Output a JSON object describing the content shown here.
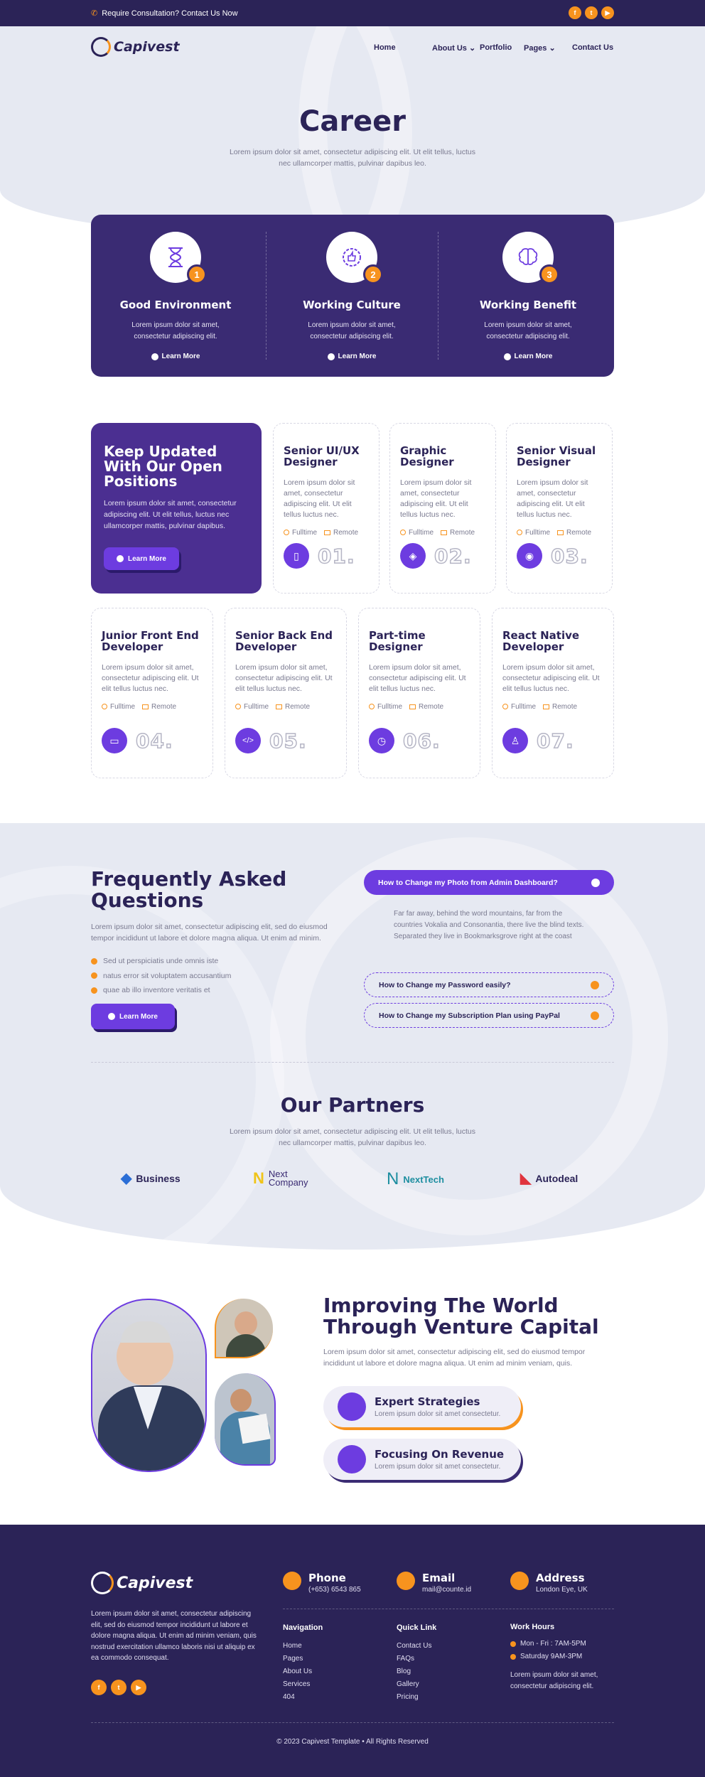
{
  "topbar": {
    "consultation": "Require Consultation? Contact Us Now",
    "socials": [
      "facebook-icon",
      "twitter-icon",
      "youtube-icon"
    ]
  },
  "brand": {
    "name": "Capivest",
    "accent": "#f7931e",
    "primary": "#2b2357",
    "purple": "#6d3ce0"
  },
  "nav": {
    "home": "Home",
    "about": "About Us",
    "portfolio": "Portfolio",
    "pages": "Pages",
    "contact": "Contact Us"
  },
  "hero": {
    "title": "Career",
    "subtitle": "Lorem ipsum dolor sit amet, consectetur adipiscing elit. Ut elit tellus, luctus nec ullamcorper mattis, pulvinar dapibus leo."
  },
  "features": [
    {
      "num": "1",
      "title": "Good Environment",
      "text": "Lorem ipsum dolor sit amet, consectetur adipiscing elit.",
      "link": "Learn More"
    },
    {
      "num": "2",
      "title": "Working Culture",
      "text": "Lorem ipsum dolor sit amet, consectetur adipiscing elit.",
      "link": "Learn More"
    },
    {
      "num": "3",
      "title": "Working Benefit",
      "text": "Lorem ipsum dolor sit amet, consectetur adipiscing elit.",
      "link": "Learn More"
    }
  ],
  "open": {
    "title": "Keep Updated With Our Open Positions",
    "text": "Lorem ipsum dolor sit amet, consectetur adipiscing elit. Ut elit tellus, luctus nec ullamcorper mattis, pulvinar dapibus.",
    "button": "Learn More"
  },
  "job_text": "Lorem ipsum dolor sit amet, consectetur adipiscing elit. Ut elit tellus luctus nec.",
  "job_type": "Fulltime",
  "job_place": "Remote",
  "jobs": [
    {
      "title": "Senior UI/UX Designer",
      "num": "01."
    },
    {
      "title": "Graphic Designer",
      "num": "02."
    },
    {
      "title": "Senior Visual Designer",
      "num": "03."
    },
    {
      "title": "Junior Front End Developer",
      "num": "04."
    },
    {
      "title": "Senior Back End Developer",
      "num": "05."
    },
    {
      "title": "Part-time Designer",
      "num": "06."
    },
    {
      "title": "React Native Developer",
      "num": "07."
    }
  ],
  "faq": {
    "title": "Frequently Asked Questions",
    "desc": "Lorem ipsum dolor sit amet, consectetur adipiscing elit, sed do eiusmod tempor incididunt ut labore et dolore magna aliqua. Ut enim ad minim.",
    "bullets": [
      "Sed ut perspiciatis unde omnis iste",
      "natus error sit voluptatem accusantium",
      "quae ab illo inventore veritatis et"
    ],
    "button": "Learn More",
    "open_q": "How to Change my Photo from Admin Dashboard?",
    "open_a": "Far far away, behind the word mountains, far from the countries Vokalia and Consonantia, there live the blind texts. Separated they live in Bookmarksgrove right at the coast",
    "q2": "How to Change my Password easily?",
    "q3": "How to Change my Subscription Plan using PayPal"
  },
  "partners": {
    "title": "Our Partners",
    "subtitle": "Lorem ipsum dolor sit amet, consectetur adipiscing elit. Ut elit tellus, luctus nec ullamcorper mattis, pulvinar dapibus leo.",
    "logos": [
      "Business",
      "Next Company",
      "NextTech",
      "Autodeal"
    ]
  },
  "improve": {
    "title": "Improving The World Through Venture Capital",
    "desc": "Lorem ipsum dolor sit amet, consectetur adipiscing elit, sed do eiusmod tempor incididunt ut labore et dolore magna aliqua. Ut enim ad minim veniam, quis.",
    "p1_title": "Expert Strategies",
    "p1_text": "Lorem ipsum dolor sit amet consectetur.",
    "p2_title": "Focusing On Revenue",
    "p2_text": "Lorem ipsum dolor sit amet consectetur."
  },
  "footer": {
    "about": "Lorem ipsum dolor sit amet, consectetur adipiscing elit, sed do eiusmod tempor incididunt ut labore et dolore magna aliqua. Ut enim ad minim veniam, quis nostrud exercitation ullamco laboris nisi ut aliquip ex ea commodo consequat.",
    "phone_label": "Phone",
    "phone": "(+653) 6543 865",
    "email_label": "Email",
    "email": "mail@counte.id",
    "address_label": "Address",
    "address": "London Eye, UK",
    "nav_title": "Navigation",
    "nav": [
      "Home",
      "Pages",
      "About Us",
      "Services",
      "404"
    ],
    "quick_title": "Quick Link",
    "quick": [
      "Contact Us",
      "FAQs",
      "Blog",
      "Gallery",
      "Pricing"
    ],
    "hours_title": "Work Hours",
    "hours1": "Mon - Fri : 7AM-5PM",
    "hours2": "Saturday 9AM-3PM",
    "hours_text": "Lorem ipsum dolor sit amet, consectetur adipiscing elit.",
    "copyright": "© 2023 Capivest Template • All Rights Reserved"
  }
}
